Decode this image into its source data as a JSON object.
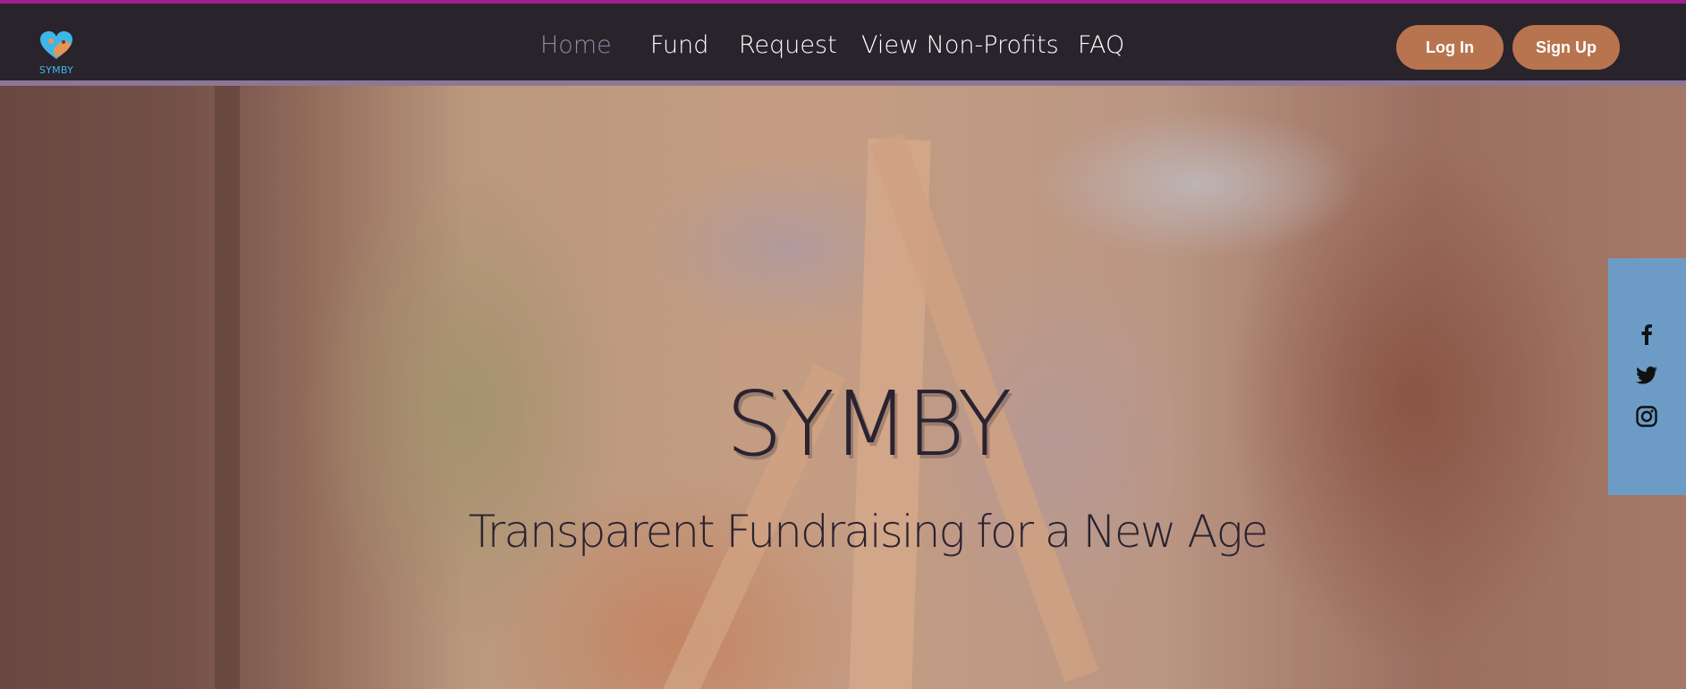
{
  "brand": {
    "logo_text": "SYMBY"
  },
  "nav": {
    "items": [
      {
        "label": "Home",
        "active": true
      },
      {
        "label": "Fund",
        "active": false
      },
      {
        "label": "Request",
        "active": false
      },
      {
        "label": "View Non-Profits",
        "active": false
      },
      {
        "label": "FAQ",
        "active": false
      }
    ]
  },
  "auth": {
    "login_label": "Log In",
    "signup_label": "Sign Up"
  },
  "hero": {
    "title": "SYMBY",
    "subtitle": "Transparent Fundraising for a New Age"
  },
  "social": {
    "icons": [
      "facebook-icon",
      "twitter-icon",
      "instagram-icon"
    ]
  },
  "colors": {
    "accent_top": "#a21e8f",
    "header_bg": "#29232c",
    "button_bg": "#b8744f",
    "social_bar": "#6c9cc6",
    "nav_active": "#8f8aa3"
  }
}
